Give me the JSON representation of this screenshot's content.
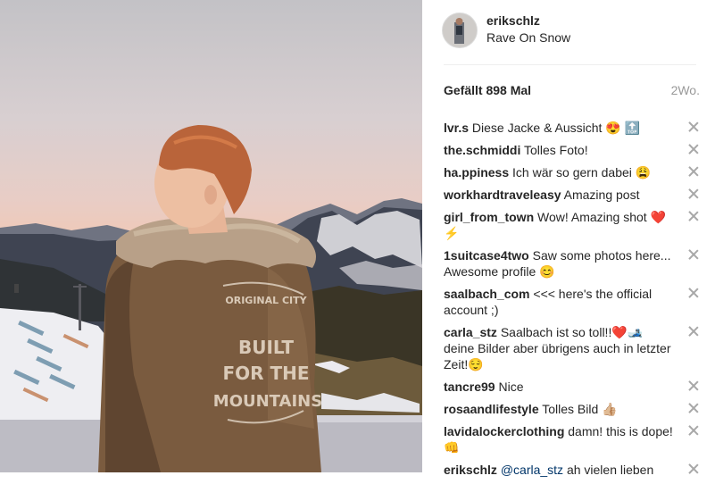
{
  "post": {
    "username": "erikschlz",
    "location": "Rave On Snow",
    "likes": "Gefällt 898 Mal",
    "age": "2Wo."
  },
  "photo": {
    "jacket_text": [
      "ORIGINAL CITY",
      "BUILT",
      "FOR THE",
      "MOUNTAINS"
    ]
  },
  "comments": [
    {
      "user": "lvr.s",
      "text": " Diese Jacke & Aussicht 😍 🔝"
    },
    {
      "user": "the.schmiddi",
      "text": " Tolles Foto!"
    },
    {
      "user": "ha.ppiness",
      "text": " Ich wär so gern dabei 😩"
    },
    {
      "user": "workhardtraveleasy",
      "text": " Amazing post"
    },
    {
      "user": "girl_from_town",
      "text": " Wow! Amazing shot ❤️⚡"
    },
    {
      "user": "1suitcase4two",
      "text": " Saw some photos here... Awesome profile 😊"
    },
    {
      "user": "saalbach_com",
      "text": " <<< here's the official account ;)"
    },
    {
      "user": "carla_stz",
      "text": " Saalbach ist so toll!!❤️🎿 deine Bilder aber übrigens auch in letzter Zeit!😌"
    },
    {
      "user": "tancre99",
      "text": " Nice"
    },
    {
      "user": "rosaandlifestyle",
      "text": " Tolles Bild 👍🏼"
    },
    {
      "user": "lavidalockerclothing",
      "text": " damn! this is dope! 👊"
    },
    {
      "user": "erikschlz",
      "mention": "@carla_stz",
      "text": " ah vielen lieben"
    }
  ],
  "colors": {
    "mention": "#003569",
    "muted": "#999999",
    "divider": "#efefef"
  }
}
